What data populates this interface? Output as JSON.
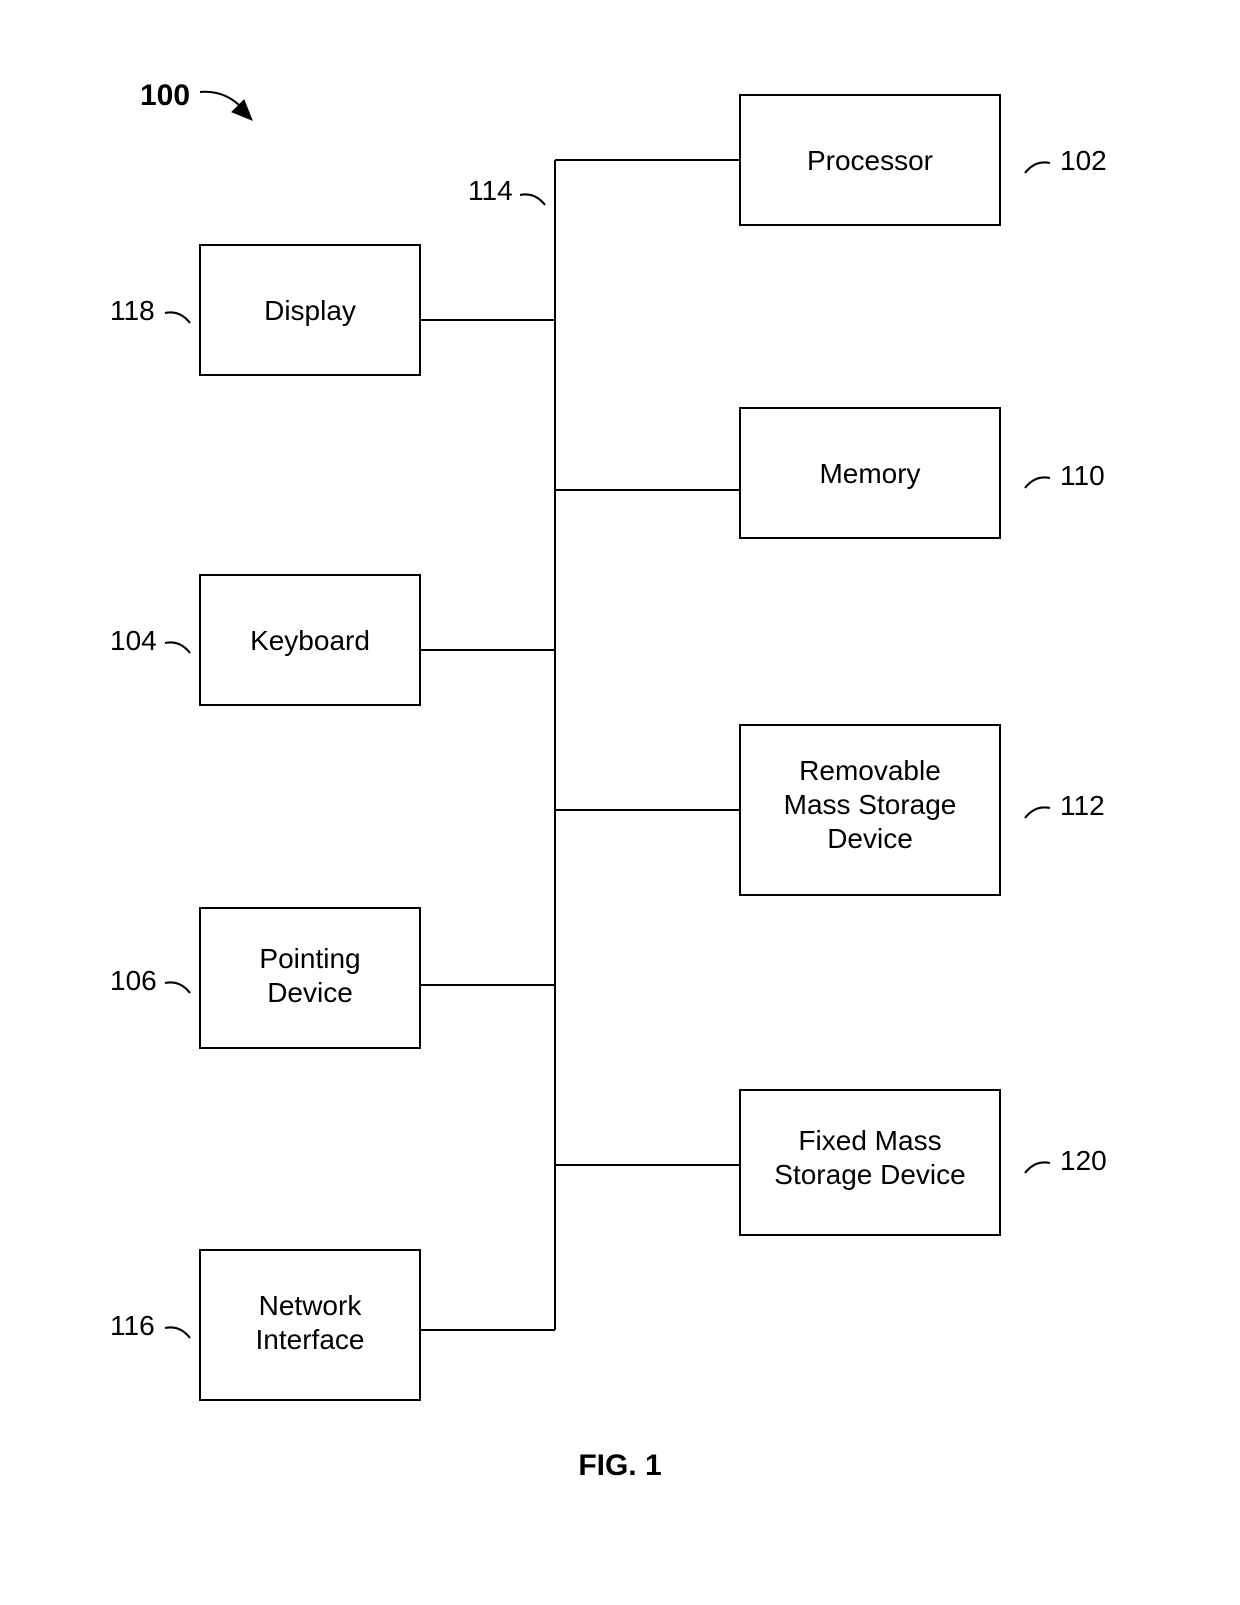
{
  "figure": {
    "caption": "FIG. 1",
    "system_ref": "100",
    "bus_ref": "114",
    "left_blocks": [
      {
        "id": "display",
        "label": "Display",
        "ref": "118"
      },
      {
        "id": "keyboard",
        "label": "Keyboard",
        "ref": "104"
      },
      {
        "id": "pointing",
        "label_line1": "Pointing",
        "label_line2": "Device",
        "ref": "106"
      },
      {
        "id": "network",
        "label_line1": "Network",
        "label_line2": "Interface",
        "ref": "116"
      }
    ],
    "right_blocks": [
      {
        "id": "processor",
        "label": "Processor",
        "ref": "102"
      },
      {
        "id": "memory",
        "label": "Memory",
        "ref": "110"
      },
      {
        "id": "removable",
        "label_line1": "Removable",
        "label_line2": "Mass Storage",
        "label_line3": "Device",
        "ref": "112"
      },
      {
        "id": "fixed",
        "label_line1": "Fixed Mass",
        "label_line2": "Storage Device",
        "ref": "120"
      }
    ]
  }
}
